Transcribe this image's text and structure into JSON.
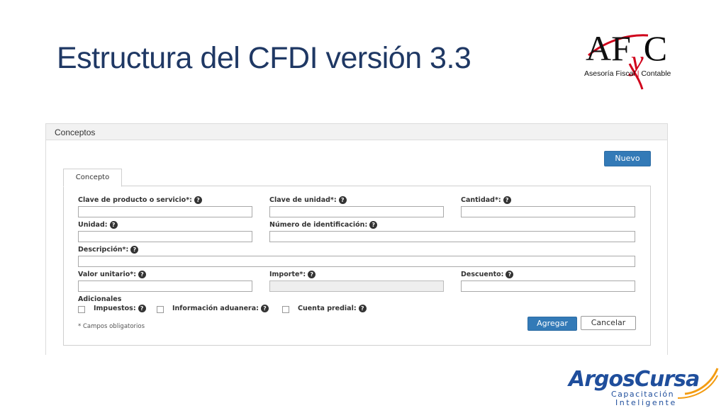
{
  "slide": {
    "title": "Estructura del CFDI versión 3.3"
  },
  "logo_afc": {
    "letters_a": "A",
    "letters_f": "F",
    "letters_y": "y",
    "letters_c": "C",
    "caption_left": "Asesoría Fiscal",
    "caption_right": "Contable"
  },
  "logo_argos": {
    "name": "ArgosCursa",
    "tagline1": "Capacitación",
    "tagline2": "Inteligente"
  },
  "panel": {
    "header": "Conceptos",
    "new_button": "Nuevo",
    "tab_label": "Concepto"
  },
  "form": {
    "clave_producto_label": "Clave de producto o servicio*:",
    "clave_unidad_label": "Clave de unidad*:",
    "cantidad_label": "Cantidad*:",
    "unidad_label": "Unidad:",
    "numero_identificacion_label": "Número de identificación:",
    "descripcion_label": "Descripción*:",
    "valor_unitario_label": "Valor unitario*:",
    "importe_label": "Importe*:",
    "descuento_label": "Descuento:",
    "adicionales_label": "Adicionales",
    "impuestos_label": "Impuestos:",
    "info_aduanera_label": "Información aduanera:",
    "cuenta_predial_label": "Cuenta predial:",
    "help_glyph": "?",
    "required_note": "* Campos obligatorios",
    "add_button": "Agregar",
    "cancel_button": "Cancelar",
    "values": {
      "clave_producto": "",
      "clave_unidad": "",
      "cantidad": "",
      "unidad": "",
      "numero_identificacion": "",
      "descripcion": "",
      "valor_unitario": "",
      "importe": "",
      "descuento": ""
    }
  },
  "colors": {
    "title": "#1f3864",
    "primary_button": "#337ab7",
    "logo_red": "#d0021b",
    "argos_blue": "#1f4e9c"
  }
}
